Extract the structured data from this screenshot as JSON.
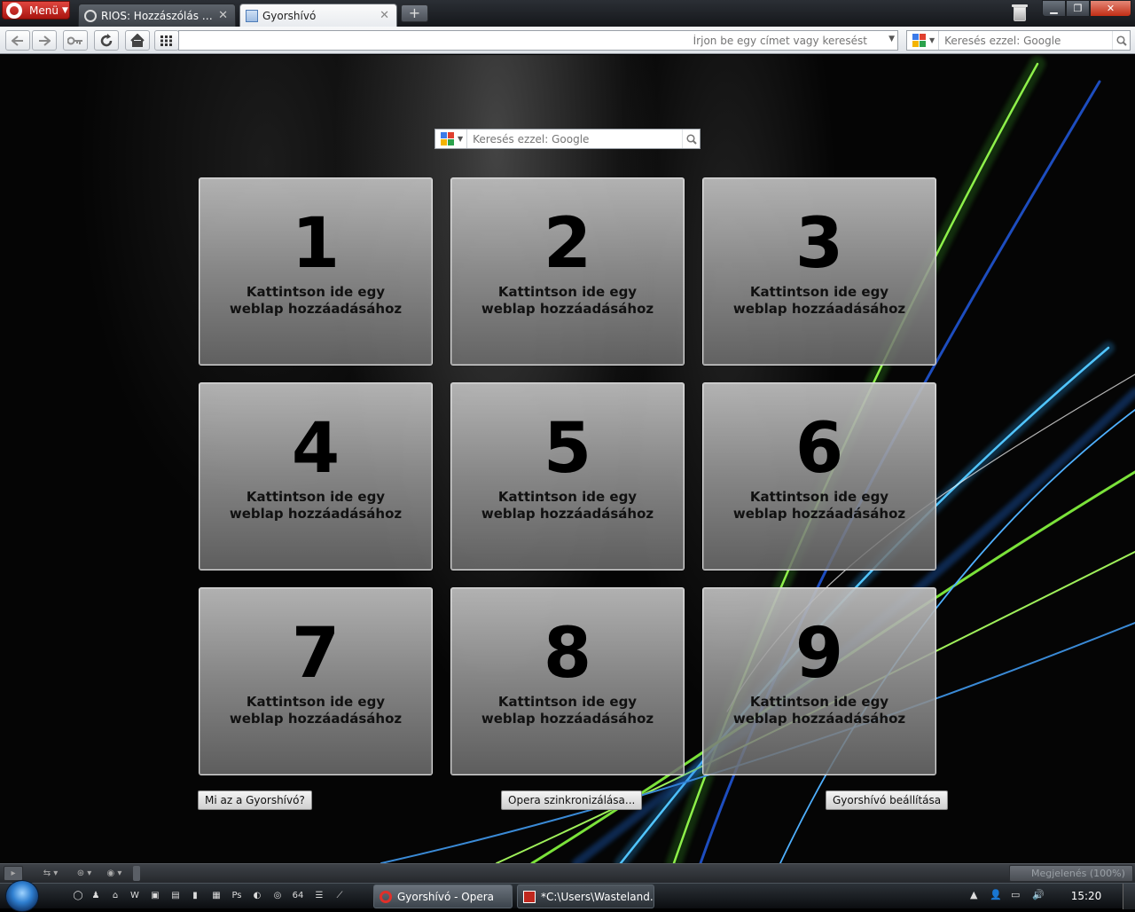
{
  "browser": {
    "menu_label": "Menü",
    "tabs": [
      {
        "label": "RIOS: Hozzászólás szer...",
        "active": false
      },
      {
        "label": "Gyorshívó",
        "active": true
      }
    ],
    "address_placeholder": "Írjon be egy címet vagy keresést",
    "toolbar_search_placeholder": "Keresés ezzel: Google"
  },
  "speed_dial": {
    "search_placeholder": "Keresés ezzel: Google",
    "tiles": [
      {
        "number": "1",
        "caption": "Kattintson ide egy weblap hozzáadásához"
      },
      {
        "number": "2",
        "caption": "Kattintson ide egy weblap hozzáadásához"
      },
      {
        "number": "3",
        "caption": "Kattintson ide egy weblap hozzáadásához"
      },
      {
        "number": "4",
        "caption": "Kattintson ide egy weblap hozzáadásához"
      },
      {
        "number": "5",
        "caption": "Kattintson ide egy weblap hozzáadásához"
      },
      {
        "number": "6",
        "caption": "Kattintson ide egy weblap hozzáadásához"
      },
      {
        "number": "7",
        "caption": "Kattintson ide egy weblap hozzáadásához"
      },
      {
        "number": "8",
        "caption": "Kattintson ide egy weblap hozzáadásához"
      },
      {
        "number": "9",
        "caption": "Kattintson ide egy weblap hozzáadásához"
      }
    ],
    "buttons": {
      "help": "Mi az a Gyorshívó?",
      "sync": "Opera szinkronizálása...",
      "settings": "Gyorshívó beállítása"
    }
  },
  "statusbar": {
    "zoom_label": "Megjelenés (100%)"
  },
  "taskbar": {
    "items": [
      {
        "label": "Gyorshívó - Opera",
        "active": true
      },
      {
        "label": "*C:\\Users\\Wasteland...",
        "active": false
      }
    ],
    "clock": "15:20"
  },
  "colors": {
    "opera_red": "#c8201a",
    "tile_bg": "#9a9a9a",
    "wave_green": "#7be23a",
    "wave_blue": "#2a8cff"
  }
}
